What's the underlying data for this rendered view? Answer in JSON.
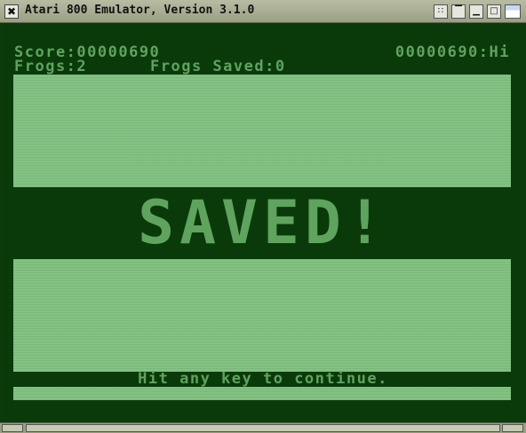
{
  "window": {
    "title": "Atari 800 Emulator, Version 3.1.0",
    "close_glyph": "✖",
    "buttons": {
      "grid_glyph": "∷",
      "shade_glyph": "▔",
      "minimize_glyph": "▁",
      "maximize_glyph": "□"
    }
  },
  "game": {
    "score": "Score:00000690",
    "hiscore": "00000690:Hi",
    "frogs": "Frogs:2",
    "frogs_saved": "Frogs Saved:0",
    "banner": "SAVED!",
    "prompt": "Hit any key to continue."
  },
  "colors": {
    "screen_bg": "#0a3a0a",
    "text_green": "#5fa35f",
    "panel_green": "#83c283",
    "titlebar": "#b7bca3"
  }
}
